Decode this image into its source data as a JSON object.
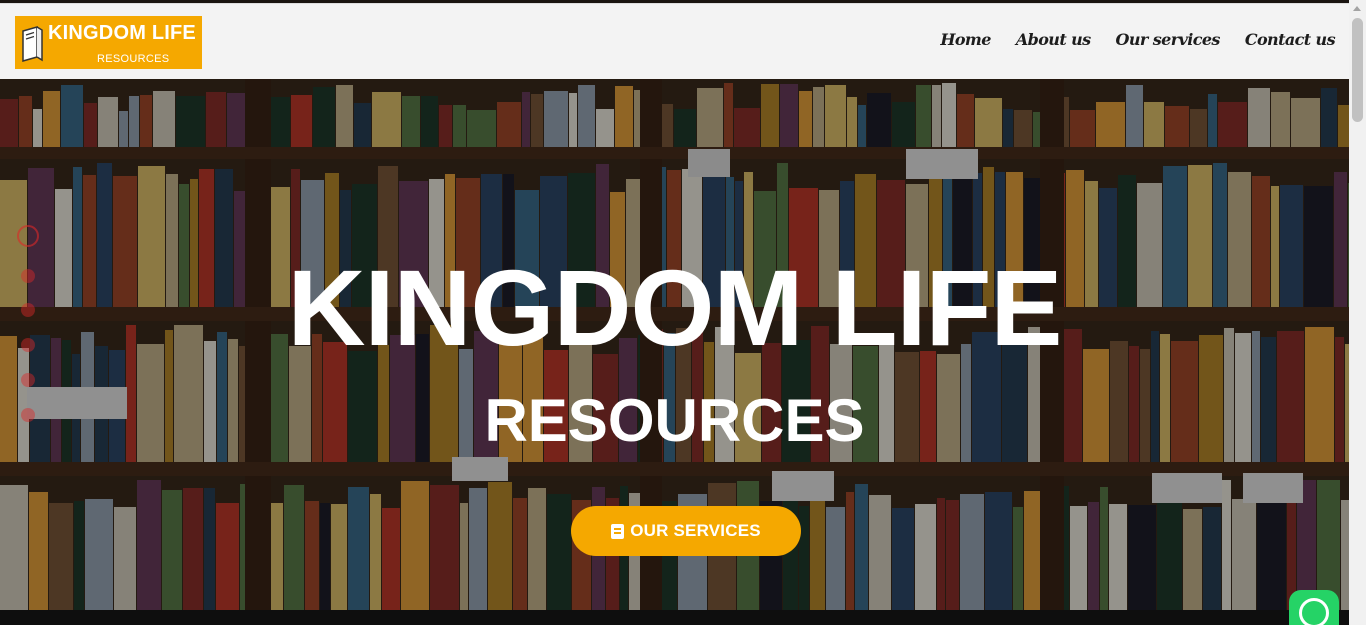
{
  "brand": {
    "logo_title": "KINGDOM LIFE",
    "logo_sub": "RESOURCES",
    "accent": "#f5a800"
  },
  "nav": {
    "items": [
      {
        "label": "Home"
      },
      {
        "label": "About us"
      },
      {
        "label": "Our services"
      },
      {
        "label": "Contact us"
      }
    ]
  },
  "hero": {
    "title": "KINGDOM LIFE",
    "subtitle": "RESOURCES",
    "cta_label": "OUR SERVICES",
    "cta_icon": "book-icon",
    "background": "bookshelf-photo"
  },
  "floating": {
    "icon": "whatsapp-icon",
    "color": "#25d366"
  }
}
